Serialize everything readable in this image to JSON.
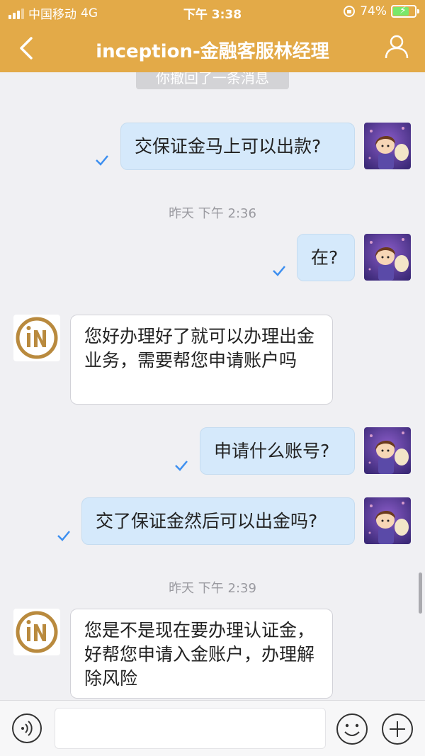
{
  "status_bar": {
    "carrier": "中国移动",
    "network": "4G",
    "time": "下午 3:38",
    "battery": "74%",
    "battery_level": 0.74
  },
  "header": {
    "title": "inception-金融客服林经理",
    "back_icon": "chevron-left-icon",
    "profile_icon": "person-icon"
  },
  "chat": {
    "recall_notice": "你撤回了一条消息",
    "messages": [
      {
        "side": "out",
        "text": "交保证金马上可以出款?"
      },
      {
        "stamp": "昨天 下午 2:36"
      },
      {
        "side": "out",
        "text": "在?"
      },
      {
        "side": "in",
        "text": "您好办理好了就可以办理出金业务，需要帮您申请账户吗"
      },
      {
        "side": "out",
        "text": "申请什么账号?"
      },
      {
        "side": "out",
        "text": "交了保证金然后可以出金吗?"
      },
      {
        "stamp": "昨天 下午 2:39"
      },
      {
        "side": "in",
        "text": "您是不是现在要办理认证金，好帮您申请入金账户，办理解除风险"
      }
    ]
  },
  "input_bar": {
    "voice_icon": "voice-icon",
    "emoji_icon": "emoji-icon",
    "plus_icon": "plus-icon",
    "placeholder": ""
  },
  "colors": {
    "header_bg": "#e3aa48",
    "outgoing_bubble": "#d5e9fb",
    "incoming_bubble": "#ffffff",
    "tick": "#3d8ff0",
    "logo_gold": "#b98a3e"
  }
}
